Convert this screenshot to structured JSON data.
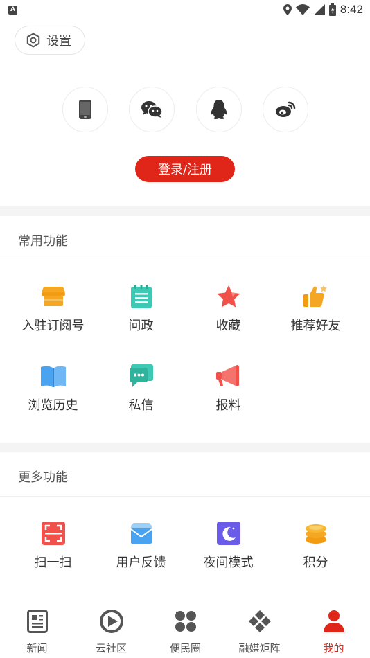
{
  "status_bar": {
    "time": "8:42",
    "notification_icon": "A"
  },
  "header": {
    "settings_label": "设置"
  },
  "login": {
    "social": [
      "phone-icon",
      "wechat-icon",
      "qq-icon",
      "weibo-icon"
    ],
    "button_label": "登录/注册",
    "accent": "#e02618"
  },
  "common": {
    "title": "常用功能",
    "items": [
      {
        "label": "入驻订阅号",
        "icon": "shop-icon"
      },
      {
        "label": "问政",
        "icon": "notepad-icon"
      },
      {
        "label": "收藏",
        "icon": "star-icon"
      },
      {
        "label": "推荐好友",
        "icon": "thumbs-up-icon"
      },
      {
        "label": "浏览历史",
        "icon": "book-icon"
      },
      {
        "label": "私信",
        "icon": "chat-icon"
      },
      {
        "label": "报料",
        "icon": "megaphone-icon"
      }
    ]
  },
  "more": {
    "title": "更多功能",
    "items": [
      {
        "label": "扫一扫",
        "icon": "scan-icon"
      },
      {
        "label": "用户反馈",
        "icon": "feedback-mail-icon"
      },
      {
        "label": "夜间模式",
        "icon": "moon-icon"
      },
      {
        "label": "积分",
        "icon": "coins-icon"
      }
    ]
  },
  "nav": {
    "items": [
      {
        "label": "新闻",
        "icon": "news-icon"
      },
      {
        "label": "云社区",
        "icon": "community-icon"
      },
      {
        "label": "便民圈",
        "icon": "clover-icon"
      },
      {
        "label": "融媒矩阵",
        "icon": "matrix-icon"
      },
      {
        "label": "我的",
        "icon": "user-icon"
      }
    ],
    "active_index": 4
  }
}
